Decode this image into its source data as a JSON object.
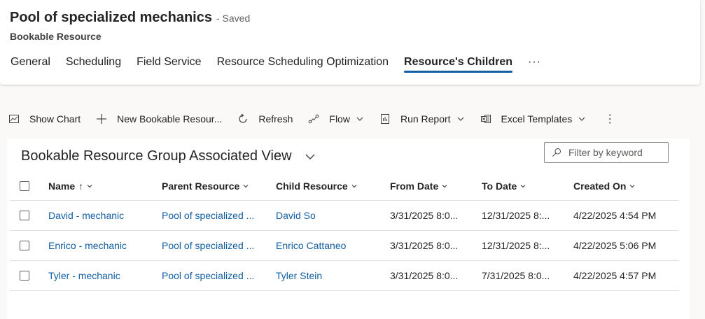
{
  "header": {
    "title": "Pool of specialized mechanics",
    "saved_status": "- Saved",
    "entity": "Bookable Resource",
    "tabs": [
      {
        "label": "General"
      },
      {
        "label": "Scheduling"
      },
      {
        "label": "Field Service"
      },
      {
        "label": "Resource Scheduling Optimization"
      },
      {
        "label": "Resource's Children"
      }
    ],
    "tabs_more": "···"
  },
  "commands": {
    "show_chart": "Show Chart",
    "new_record": "New Bookable Resour...",
    "refresh": "Refresh",
    "flow": "Flow",
    "run_report": "Run Report",
    "excel_templates": "Excel Templates",
    "more": "⋮"
  },
  "view": {
    "title": "Bookable Resource Group Associated View",
    "filter_placeholder": "Filter by keyword"
  },
  "grid": {
    "columns": {
      "name": "Name",
      "sort_arrow": "↑",
      "parent": "Parent Resource",
      "child": "Child Resource",
      "from": "From Date",
      "to": "To Date",
      "created": "Created On"
    },
    "rows": [
      {
        "name": "David - mechanic",
        "parent": "Pool of specialized ...",
        "child": "David So",
        "from": "3/31/2025 8:0...",
        "to": "12/31/2025 8:...",
        "created": "4/22/2025 4:54 PM"
      },
      {
        "name": "Enrico - mechanic",
        "parent": "Pool of specialized ...",
        "child": "Enrico Cattaneo",
        "from": "3/31/2025 8:0...",
        "to": "12/31/2025 8:...",
        "created": "4/22/2025 5:06 PM"
      },
      {
        "name": "Tyler - mechanic",
        "parent": "Pool of specialized ...",
        "child": "Tyler Stein",
        "from": "3/31/2025 8:0...",
        "to": "7/31/2025 8:0...",
        "created": "4/22/2025 4:57 PM"
      }
    ]
  },
  "colors": {
    "link": "#115ea3",
    "tab_underline": "#115ea3",
    "background": "#faf9f8"
  }
}
